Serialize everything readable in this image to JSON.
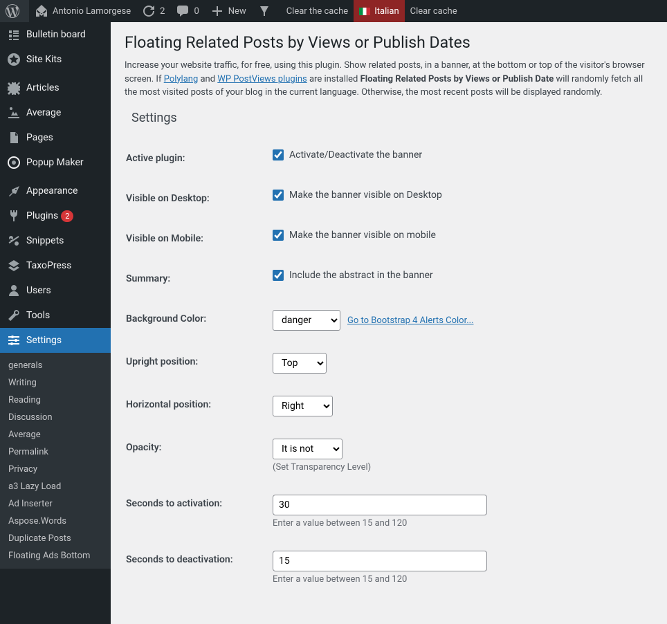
{
  "adminbar": {
    "site_name": "Antonio Lamorgese",
    "refresh_count": "2",
    "comments_count": "0",
    "new_label": "New",
    "clear_cache_1": "Clear the cache",
    "italian_label": "Italian",
    "clear_cache_2": "Clear cache"
  },
  "sidebar": {
    "items": [
      {
        "label": "Bulletin board"
      },
      {
        "label": "Site Kits"
      },
      {
        "label": "Articles"
      },
      {
        "label": "Average"
      },
      {
        "label": "Pages"
      },
      {
        "label": "Popup Maker"
      },
      {
        "label": "Appearance"
      },
      {
        "label": "Plugins",
        "badge": "2"
      },
      {
        "label": "Snippets"
      },
      {
        "label": "TaxoPress"
      },
      {
        "label": "Users"
      },
      {
        "label": "Tools"
      },
      {
        "label": "Settings"
      }
    ],
    "submenu": [
      {
        "label": "generals"
      },
      {
        "label": "Writing"
      },
      {
        "label": "Reading"
      },
      {
        "label": "Discussion"
      },
      {
        "label": "Average"
      },
      {
        "label": "Permalink"
      },
      {
        "label": "Privacy"
      },
      {
        "label": "a3 Lazy Load"
      },
      {
        "label": "Ad Inserter"
      },
      {
        "label": "Aspose.Words"
      },
      {
        "label": "Duplicate Posts"
      },
      {
        "label": "Floating Ads Bottom"
      }
    ]
  },
  "page": {
    "title": "Floating Related Posts by Views or Publish Dates",
    "desc_1": "Increase your website traffic, for free, using this plugin. Show related posts, in a banner, at the bottom or top of the visitor's browser screen. If ",
    "polylang_link": "Polylang",
    "desc_and": " and ",
    "wp_postviews_link": "WP PostViews plugins",
    "desc_2": " are installed ",
    "bold": "Floating Related Posts by Views or Publish Date",
    "desc_3": " will randomly fetch all the most visited posts of your blog in the current language. Otherwise, the most recent posts will be displayed randomly.",
    "settings_heading": "Settings"
  },
  "form": {
    "active_plugin": {
      "label": "Active plugin:",
      "checkbox": "Activate/Deactivate the banner"
    },
    "visible_desktop": {
      "label": "Visible on Desktop:",
      "checkbox": "Make the banner visible on Desktop"
    },
    "visible_mobile": {
      "label": "Visible on Mobile:",
      "checkbox": "Make the banner visible on mobile"
    },
    "summary": {
      "label": "Summary:",
      "checkbox": "Include the abstract in the banner"
    },
    "background_color": {
      "label": "Background Color:",
      "selected": "danger",
      "link": "Go to Bootstrap 4 Alerts Color..."
    },
    "upright_position": {
      "label": "Upright position:",
      "selected": "Top"
    },
    "horizontal_position": {
      "label": "Horizontal position:",
      "selected": "Right"
    },
    "opacity": {
      "label": "Opacity:",
      "selected": "It is not",
      "hint": "(Set Transparency Level)"
    },
    "seconds_activation": {
      "label": "Seconds to activation:",
      "value": "30",
      "hint": "Enter a value between 15 and 120"
    },
    "seconds_deactivation": {
      "label": "Seconds to deactivation:",
      "value": "15",
      "hint": "Enter a value between 15 and 120"
    }
  }
}
